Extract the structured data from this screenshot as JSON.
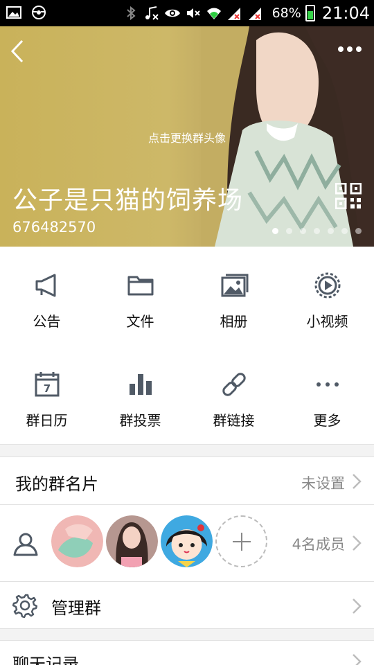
{
  "status_bar": {
    "battery_percent": "68%",
    "time": "21:04"
  },
  "header": {
    "change_avatar_hint": "点击更换群头像",
    "group_name": "公子是只猫的饲养场",
    "group_id": "676482570",
    "page_dots": {
      "count": 7,
      "active_index": 0
    }
  },
  "features": [
    {
      "label": "公告",
      "icon": "megaphone-icon"
    },
    {
      "label": "文件",
      "icon": "folder-icon"
    },
    {
      "label": "相册",
      "icon": "photo-album-icon"
    },
    {
      "label": "小视频",
      "icon": "video-icon"
    },
    {
      "label": "群日历",
      "icon": "calendar-icon"
    },
    {
      "label": "群投票",
      "icon": "bar-chart-icon"
    },
    {
      "label": "群链接",
      "icon": "link-icon"
    },
    {
      "label": "更多",
      "icon": "more-icon"
    }
  ],
  "my_card": {
    "title": "我的群名片",
    "value": "未设置"
  },
  "members": {
    "count_label": "4名成员"
  },
  "manage": {
    "title": "管理群"
  },
  "chat_history": {
    "title": "聊天记录"
  },
  "colors": {
    "icon_gray": "#505a66",
    "cover_gold": "#c9b25a",
    "accent_link": "#4a4f57"
  }
}
